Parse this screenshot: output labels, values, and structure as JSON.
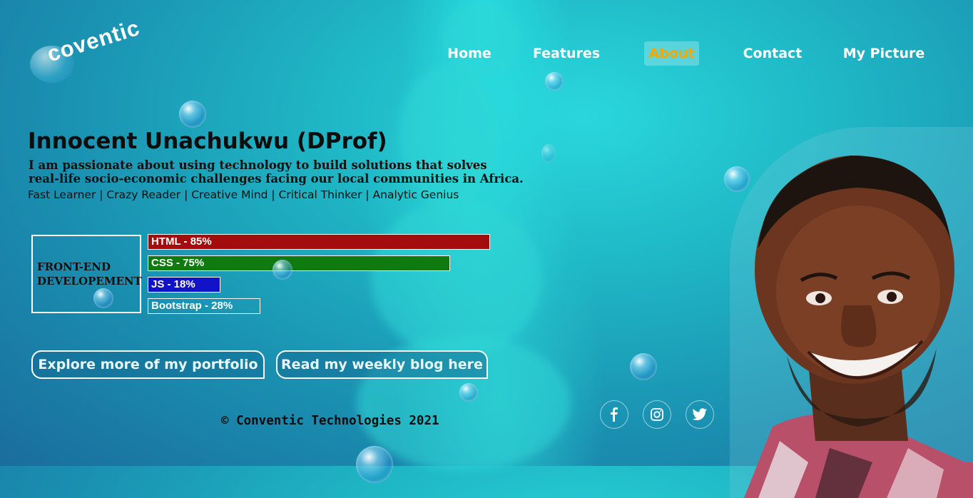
{
  "brand": {
    "logo_text": "coventic"
  },
  "nav": {
    "items": [
      {
        "label": "Home",
        "active": false
      },
      {
        "label": "Features",
        "active": false
      },
      {
        "label": "About",
        "active": true
      },
      {
        "label": "Contact",
        "active": false
      },
      {
        "label": "My Picture",
        "active": false
      }
    ],
    "active_color": "#f5a800"
  },
  "hero": {
    "name": "Innocent Unachukwu (DProf)",
    "bio_line1": "I am passionate about using technology to build solutions that solves",
    "bio_line2": "real-life socio-economic challenges facing our local communities in Africa.",
    "traits": "Fast Learner | Crazy Reader | Creative Mind | Critical Thinker | Analytic Genius"
  },
  "skills": {
    "title_line1": "FRONT-END",
    "title_line2": "DEVELOPEMENT",
    "bars": [
      {
        "label": "HTML - 85%",
        "percent": 85,
        "color": "#a30d0d"
      },
      {
        "label": "CSS - 75%",
        "percent": 75,
        "color": "#0f7a0f"
      },
      {
        "label": "JS - 18%",
        "percent": 18,
        "color": "#1212c8"
      },
      {
        "label": "Bootstrap - 28%",
        "percent": 28,
        "color": "transparent"
      }
    ]
  },
  "actions": {
    "portfolio_label": "Explore more of my portfolio",
    "blog_label": "Read my weekly blog here"
  },
  "footer": {
    "copyright": "© Conventic Technologies 2021",
    "social": [
      "facebook-icon",
      "instagram-icon",
      "twitter-icon"
    ]
  }
}
